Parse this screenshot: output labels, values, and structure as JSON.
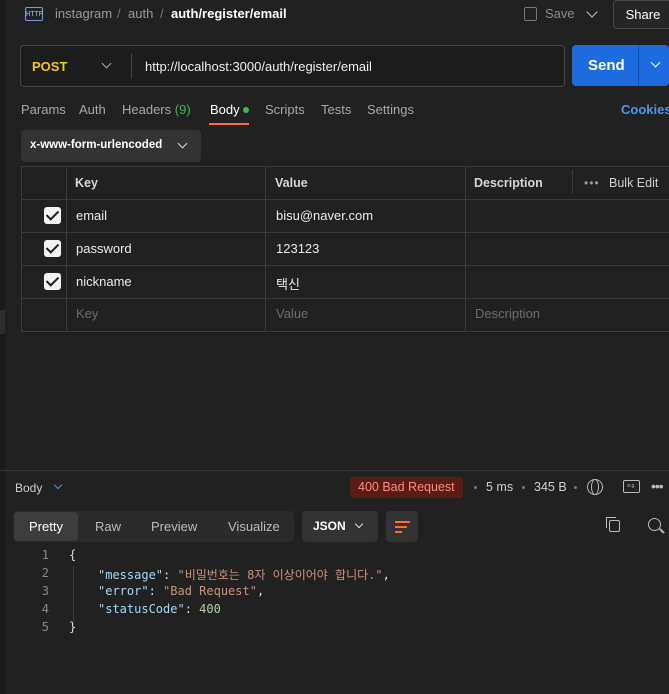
{
  "breadcrumb": {
    "icon": "http-icon",
    "icon_text": "HTTP",
    "items": [
      "instagram",
      "auth",
      "auth/register/email"
    ],
    "sep": "/"
  },
  "toolbar": {
    "save_label": "Save",
    "share_label": "Share"
  },
  "request": {
    "method": "POST",
    "url": "http://localhost:3000/auth/register/email",
    "send_label": "Send"
  },
  "tabs": {
    "params": "Params",
    "auth": "Auth",
    "headers": "Headers",
    "headers_count": "(9)",
    "body": "Body",
    "scripts": "Scripts",
    "tests": "Tests",
    "settings": "Settings",
    "cookies": "Cookies"
  },
  "body_type": "x-www-form-urlencoded",
  "table": {
    "headers": {
      "key": "Key",
      "value": "Value",
      "description": "Description",
      "bulk_edit": "Bulk Edit"
    },
    "rows": [
      {
        "checked": true,
        "key": "email",
        "value": "bisu@naver.com"
      },
      {
        "checked": true,
        "key": "password",
        "value": "123123"
      },
      {
        "checked": true,
        "key": "nickname",
        "value": "택신"
      }
    ],
    "placeholders": {
      "key": "Key",
      "value": "Value",
      "description": "Description"
    }
  },
  "response": {
    "label": "Body",
    "status": "400 Bad Request",
    "time": "5 ms",
    "size": "345 B",
    "tabs": [
      "Pretty",
      "Raw",
      "Preview",
      "Visualize"
    ],
    "active_tab": "Pretty",
    "format": "JSON",
    "line_numbers": [
      "1",
      "2",
      "3",
      "4",
      "5"
    ],
    "json": {
      "open": "{",
      "close": "}",
      "message_key": "\"message\"",
      "message_val": "\"비밀번호는 8자 이상이어야 합니다.\"",
      "error_key": "\"error\"",
      "error_val": "\"Bad Request\"",
      "status_key": "\"statusCode\"",
      "status_val": "400"
    }
  },
  "colors": {
    "accent": "#ff6c37",
    "send": "#1c6ce0",
    "method": "#f5c518",
    "status_bg": "#5a1c14"
  }
}
